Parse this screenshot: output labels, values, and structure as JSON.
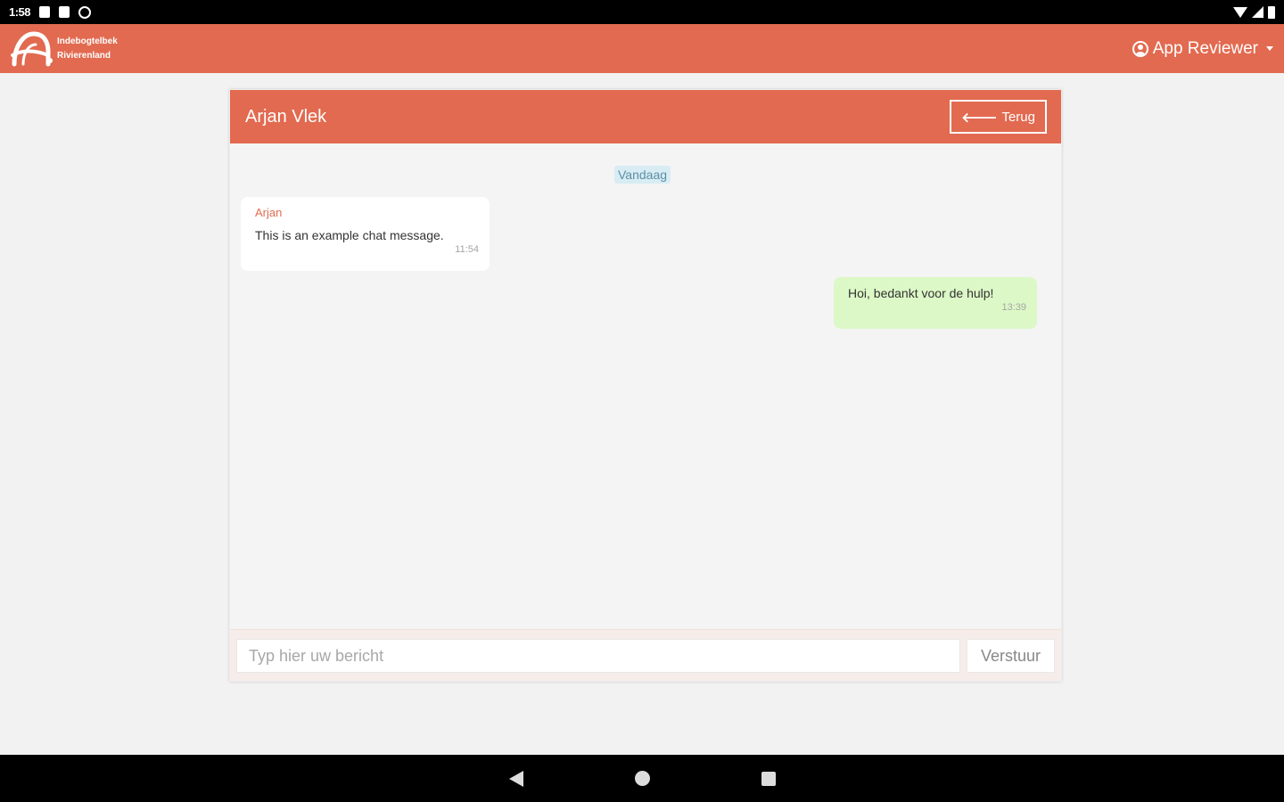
{
  "status_bar": {
    "time": "1:58",
    "icons": [
      "notification-icon",
      "sd-card-icon",
      "sync-icon",
      "wifi-icon",
      "signal-icon",
      "battery-icon"
    ]
  },
  "app_bar": {
    "brand_line1": "Indebogtelbek",
    "brand_line2": "Rivierenland",
    "user_name": "App Reviewer",
    "accent_color": "#e26a50"
  },
  "chat": {
    "contact_name": "Arjan Vlek",
    "back_label": "Terug",
    "date_separator": "Vandaag",
    "messages": [
      {
        "direction": "in",
        "sender": "Arjan",
        "text": "This is an example chat message.",
        "time": "11:54"
      },
      {
        "direction": "out",
        "text": "Hoi, bedankt voor de hulp!",
        "time": "13:39"
      }
    ],
    "composer": {
      "placeholder": "Typ hier uw bericht",
      "value": "",
      "send_label": "Verstuur"
    }
  }
}
